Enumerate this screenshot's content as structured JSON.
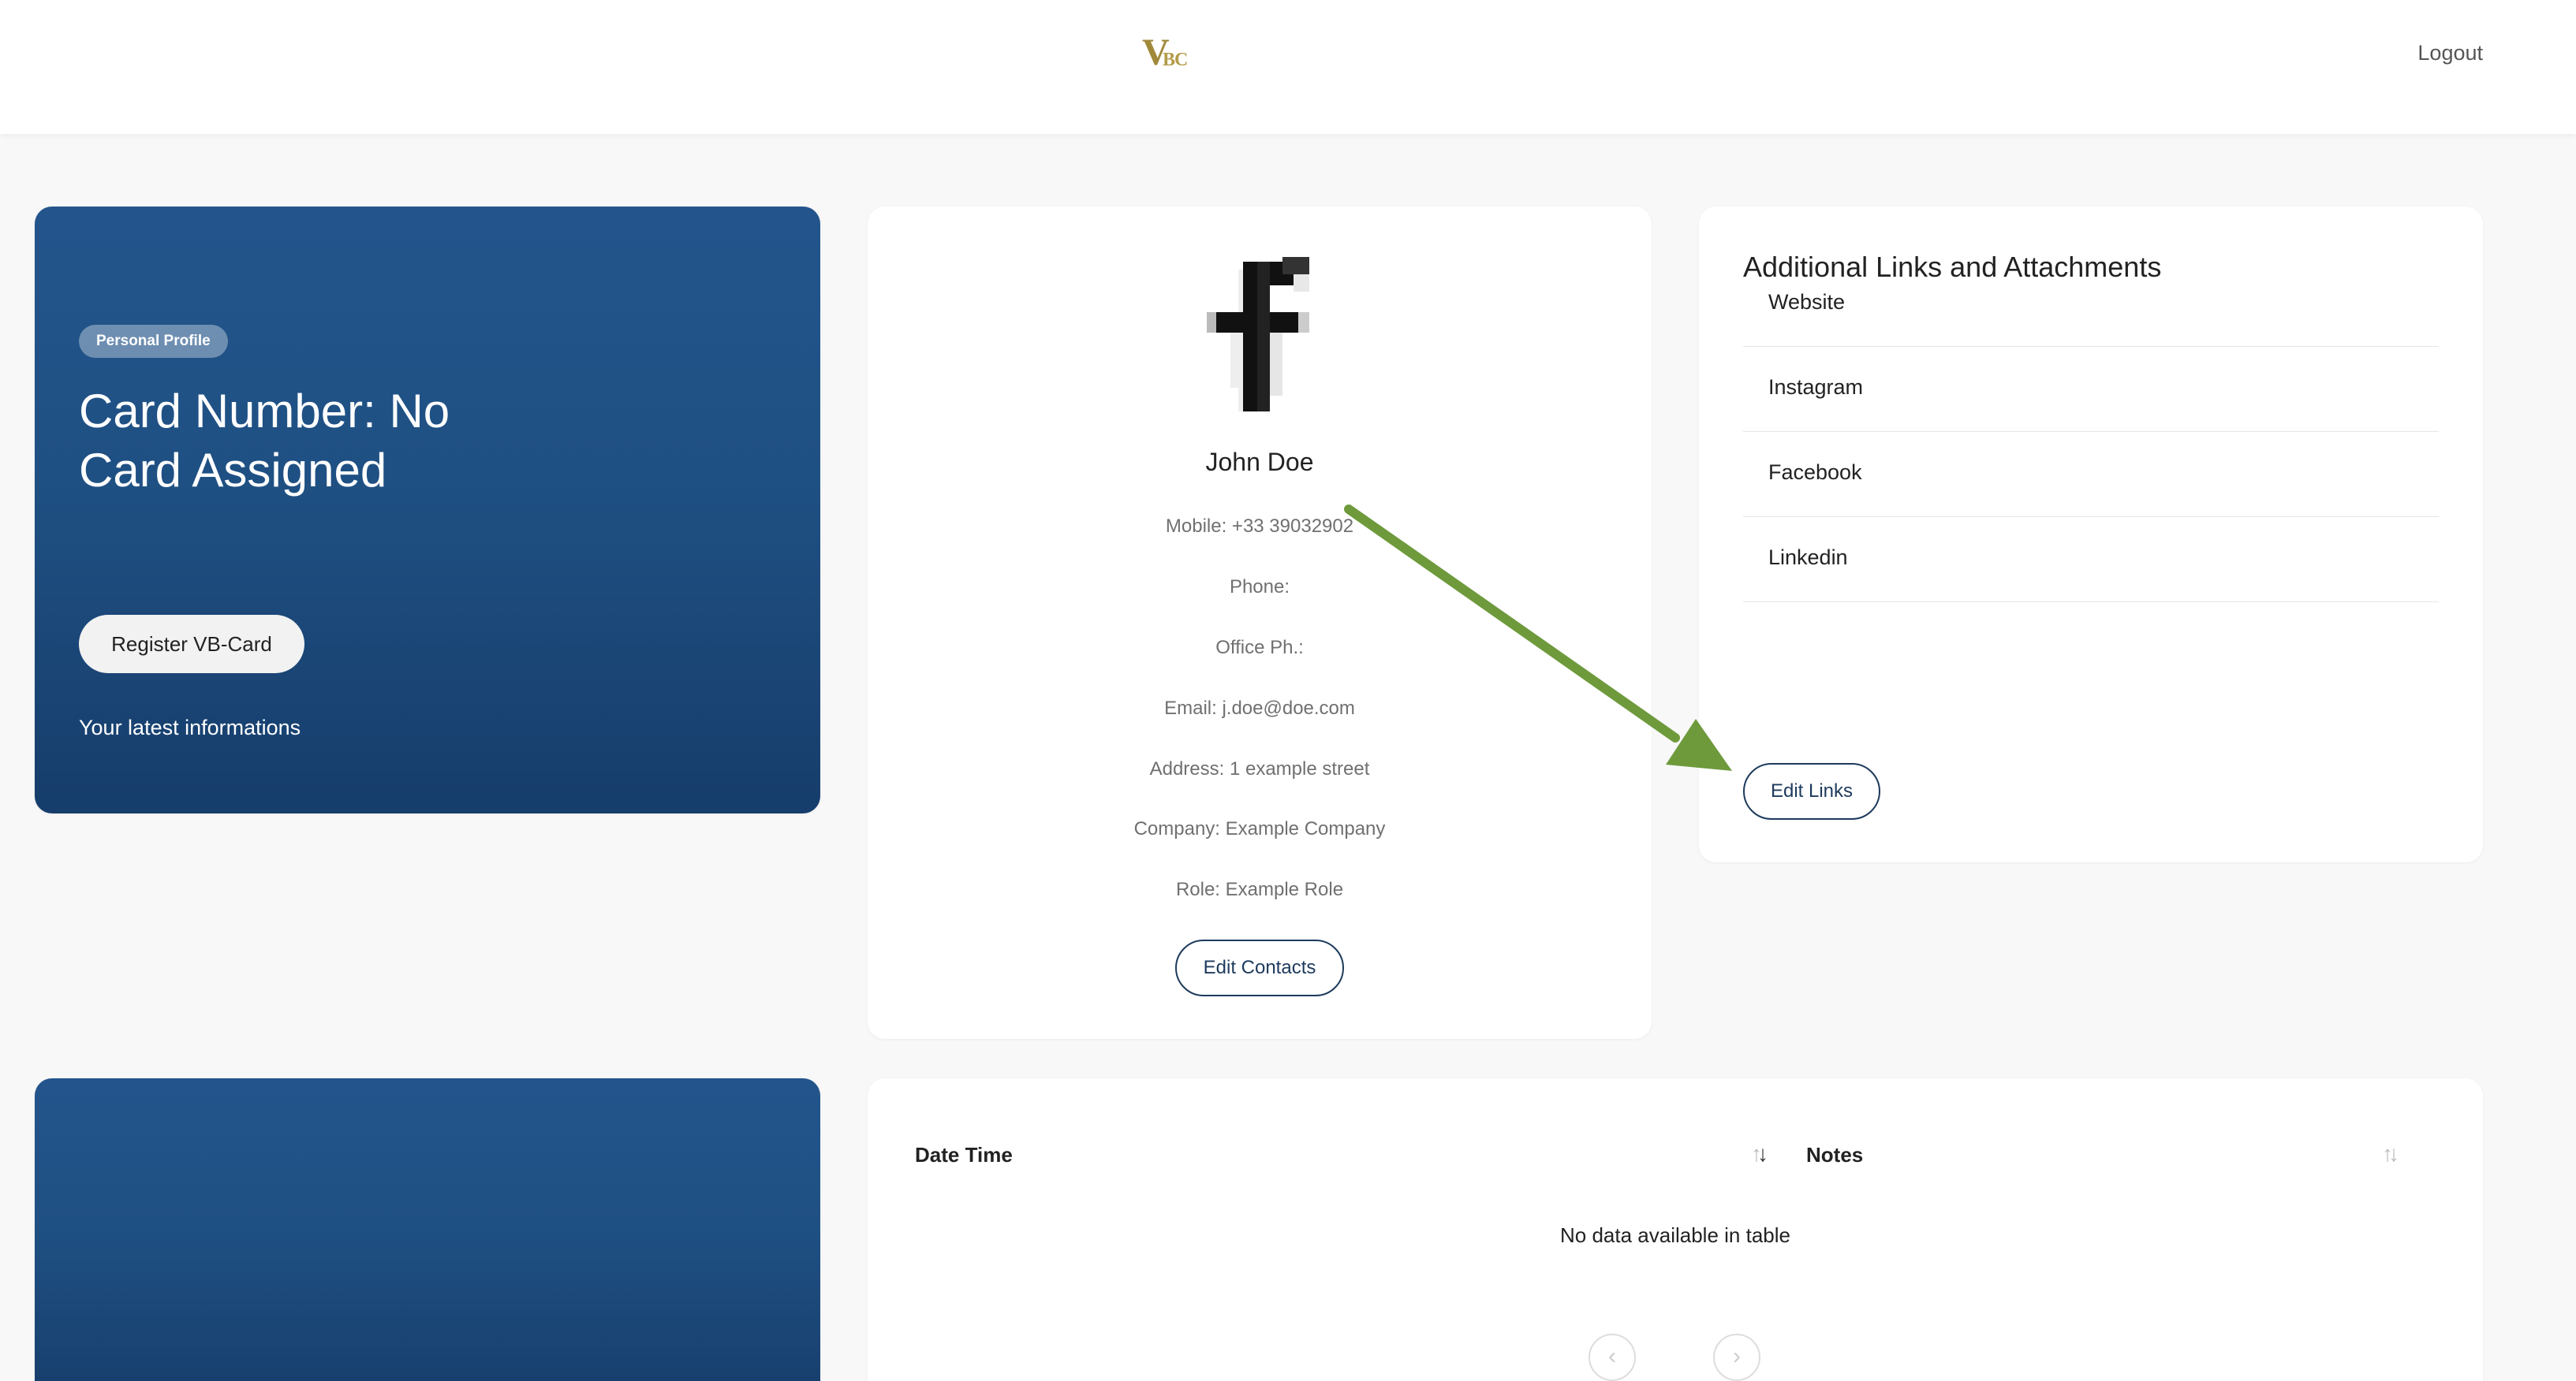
{
  "header": {
    "logo_v": "V",
    "logo_bc": "BC",
    "logout_label": "Logout"
  },
  "hero": {
    "badge": "Personal Profile",
    "card_number": "Card Number: No Card Assigned",
    "register_label": "Register VB-Card",
    "latest_label": "Your latest informations"
  },
  "profile": {
    "avatar_icon": "facebook-icon",
    "name": "John Doe",
    "mobile": "Mobile: +33 39032902",
    "phone": "Phone:",
    "office": "Office Ph.:",
    "email": "Email: j.doe@doe.com",
    "address": "Address: 1 example street",
    "company": "Company: Example Company",
    "role": "Role: Example Role",
    "edit_label": "Edit Contacts"
  },
  "links": {
    "title": "Additional Links and Attachments",
    "items": [
      "Linkedin",
      "Facebook",
      "Instagram",
      "Website"
    ],
    "edit_label": "Edit Links"
  },
  "table": {
    "columns": [
      "Date Time",
      "Notes"
    ],
    "empty_message": "No data available in table",
    "prev_icon": "chevron-left-icon",
    "next_icon": "chevron-right-icon"
  },
  "colors": {
    "primary_blue": "#1f5083",
    "button_border": "#1d3a5c",
    "annotation_arrow": "#6e9a3c",
    "logo_gold": "#a08a3a"
  }
}
